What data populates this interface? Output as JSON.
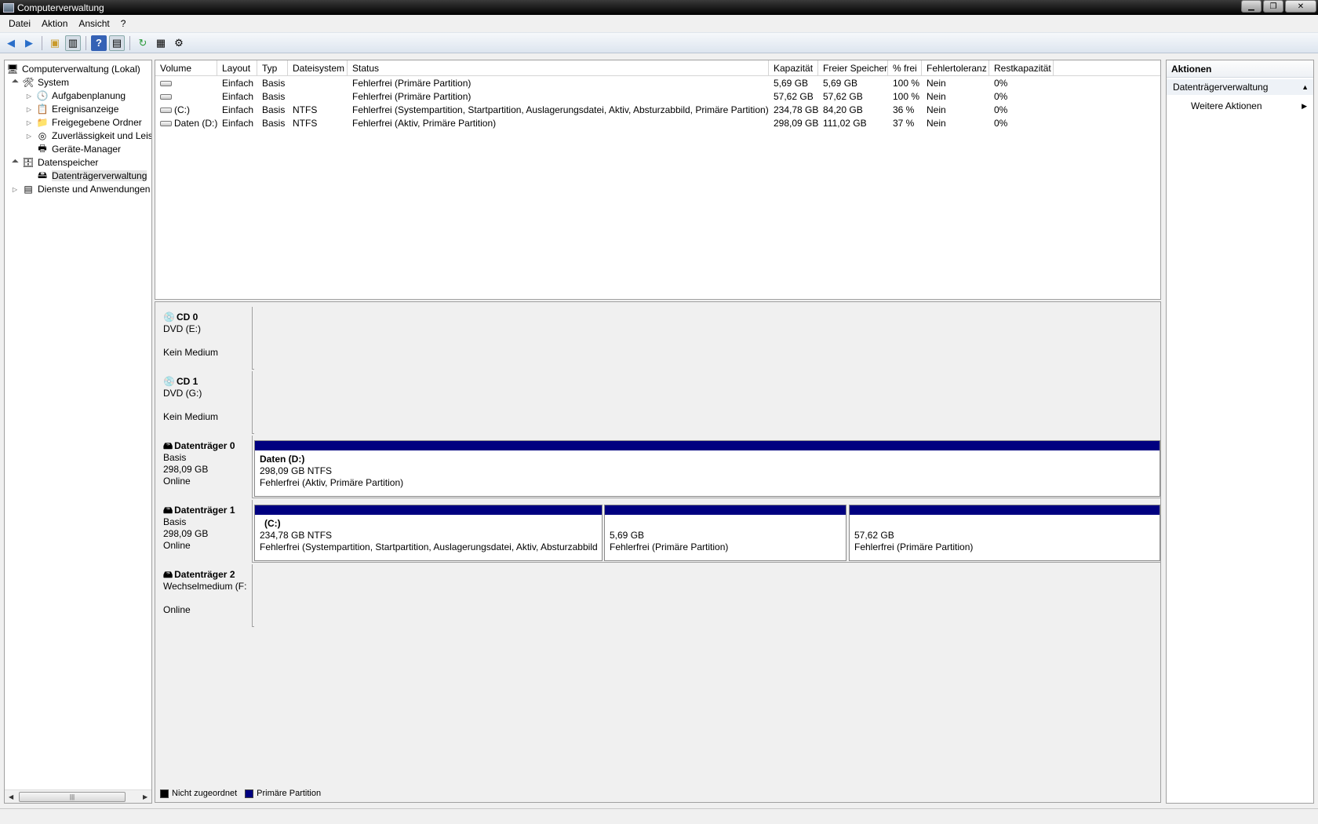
{
  "window": {
    "title": "Computerverwaltung"
  },
  "menubar": {
    "items": [
      "Datei",
      "Aktion",
      "Ansicht",
      "?"
    ]
  },
  "tree": {
    "nodes": [
      {
        "label": "Computerverwaltung (Lokal)",
        "icon": "computer-management-icon",
        "level": 0,
        "expander": ""
      },
      {
        "label": "System",
        "icon": "system-tools-icon",
        "level": 1,
        "expander": "▲"
      },
      {
        "label": "Aufgabenplanung",
        "icon": "task-scheduler-icon",
        "level": 2,
        "expander": "▷"
      },
      {
        "label": "Ereignisanzeige",
        "icon": "event-viewer-icon",
        "level": 2,
        "expander": "▷"
      },
      {
        "label": "Freigegebene Ordner",
        "icon": "shared-folders-icon",
        "level": 2,
        "expander": "▷"
      },
      {
        "label": "Zuverlässigkeit und Leis",
        "icon": "reliability-icon",
        "level": 2,
        "expander": "▷"
      },
      {
        "label": "Geräte-Manager",
        "icon": "device-manager-icon",
        "level": 2,
        "expander": ""
      },
      {
        "label": "Datenspeicher",
        "icon": "storage-icon",
        "level": 1,
        "expander": "▲"
      },
      {
        "label": "Datenträgerverwaltung",
        "icon": "disk-management-icon",
        "level": 2,
        "expander": "",
        "selected": true
      },
      {
        "label": "Dienste und Anwendungen",
        "icon": "services-icon",
        "level": 1,
        "expander": "▷"
      }
    ]
  },
  "volume_list": {
    "columns": [
      "Volume",
      "Layout",
      "Typ",
      "Dateisystem",
      "Status",
      "Kapazität",
      "Freier Speicher",
      "% frei",
      "Fehlertoleranz",
      "Restkapazität"
    ],
    "rows": [
      [
        "",
        "Einfach",
        "Basis",
        "",
        "Fehlerfrei (Primäre Partition)",
        "5,69 GB",
        "5,69 GB",
        "100 %",
        "Nein",
        "0%"
      ],
      [
        "",
        "Einfach",
        "Basis",
        "",
        "Fehlerfrei (Primäre Partition)",
        "57,62 GB",
        "57,62 GB",
        "100 %",
        "Nein",
        "0%"
      ],
      [
        "(C:)",
        "Einfach",
        "Basis",
        "NTFS",
        "Fehlerfrei (Systempartition, Startpartition, Auslagerungsdatei, Aktiv, Absturzabbild, Primäre Partition)",
        "234,78 GB",
        "84,20 GB",
        "36 %",
        "Nein",
        "0%"
      ],
      [
        "Daten (D:)",
        "Einfach",
        "Basis",
        "NTFS",
        "Fehlerfrei (Aktiv, Primäre Partition)",
        "298,09 GB",
        "111,02 GB",
        "37 %",
        "Nein",
        "0%"
      ]
    ]
  },
  "disks": [
    {
      "name": "CD 0",
      "lines": [
        "DVD (E:)",
        "",
        "Kein Medium"
      ],
      "icon": "cd-drive-icon",
      "partitions": []
    },
    {
      "name": "CD 1",
      "lines": [
        "DVD (G:)",
        "",
        "Kein Medium"
      ],
      "icon": "cd-drive-icon",
      "partitions": []
    },
    {
      "name": "Datenträger 0",
      "lines": [
        "Basis",
        "298,09 GB",
        "Online"
      ],
      "icon": "hard-disk-icon",
      "partitions": [
        {
          "name": "Daten  (D:)",
          "size": "298,09 GB NTFS",
          "status": "Fehlerfrei (Aktiv, Primäre Partition)"
        }
      ]
    },
    {
      "name": "Datenträger 1",
      "lines": [
        "Basis",
        "298,09 GB",
        "Online"
      ],
      "icon": "hard-disk-icon",
      "partitions": [
        {
          "name": "(C:)",
          "size": "234,78 GB NTFS",
          "status": "Fehlerfrei (Systempartition, Startpartition, Auslagerungsdatei, Aktiv, Absturzabbild"
        },
        {
          "name": "",
          "size": "5,69 GB",
          "status": "Fehlerfrei (Primäre Partition)"
        },
        {
          "name": "",
          "size": "57,62 GB",
          "status": "Fehlerfrei (Primäre Partition)"
        }
      ]
    },
    {
      "name": "Datenträger 2",
      "lines": [
        "Wechselmedium (F:",
        "",
        "Online"
      ],
      "icon": "removable-disk-icon",
      "partitions": []
    }
  ],
  "legend": [
    {
      "label": "Nicht zugeordnet",
      "color": "#000000"
    },
    {
      "label": "Primäre Partition",
      "color": "#000080"
    }
  ],
  "actions": {
    "title": "Aktionen",
    "section": "Datenträgerverwaltung",
    "item": "Weitere Aktionen"
  }
}
